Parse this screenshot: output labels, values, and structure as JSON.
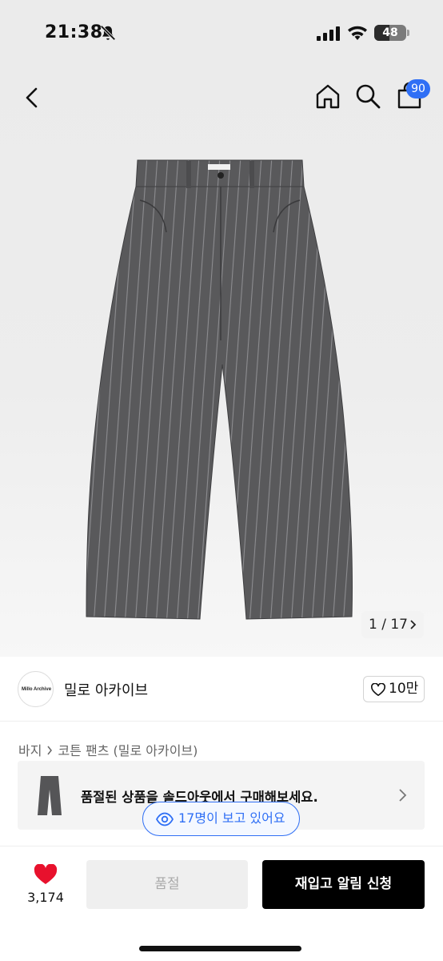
{
  "status_bar": {
    "time": "21:38",
    "battery": "48",
    "battery_level": 0.48,
    "icons": [
      "bell-slash-icon",
      "signal-icon",
      "wifi-icon",
      "battery-icon"
    ]
  },
  "nav": {
    "icons": [
      "back-chevron-icon",
      "home-icon",
      "search-icon",
      "cart-bag-icon"
    ],
    "cart_badge": "90",
    "accent_color": "#2f6ff5"
  },
  "gallery": {
    "counter": "1 / 17"
  },
  "brand": {
    "logo_text": "Millo Archive",
    "name": "밀로 아카이브",
    "likes": "10만"
  },
  "breadcrumb": {
    "items": [
      "바지",
      "코튼 팬츠 (밀로 아카이브)"
    ]
  },
  "soldout_banner": {
    "text": "품절된 상품을 솔드아웃에서 구매해보세요."
  },
  "viewers": {
    "text": "17명이 보고 있어요"
  },
  "bottom_bar": {
    "heart_count": "3,174",
    "heart_color": "#e8112d",
    "soldout_label": "품절",
    "restock_label": "재입고 알림 신청"
  }
}
